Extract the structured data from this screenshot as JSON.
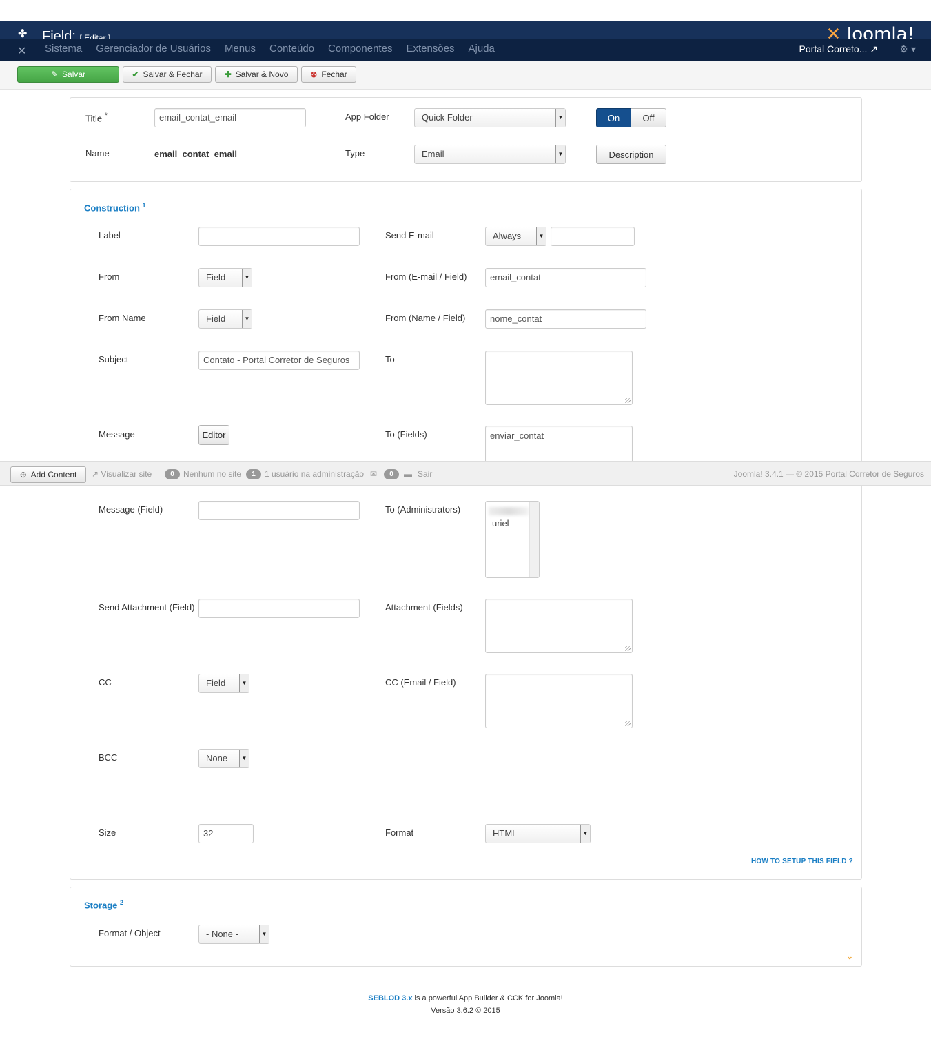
{
  "header": {
    "title": "Field:",
    "subtitle": "[ Editar ]",
    "brand": "Joomla!",
    "nav": [
      "Sistema",
      "Gerenciador de Usuários",
      "Menus",
      "Conteúdo",
      "Componentes",
      "Extensões",
      "Ajuda"
    ],
    "site_link": "Portal Correto...",
    "icons": {
      "site_logo": "joomla-icon",
      "gear": "gear-icon",
      "external": "external-link-icon"
    }
  },
  "toolbar": {
    "save": "Salvar",
    "save_close": "Salvar & Fechar",
    "save_new": "Salvar & Novo",
    "close": "Fechar"
  },
  "general": {
    "title_label": "Title",
    "title_required": "*",
    "title_value": "email_contat_email",
    "name_label": "Name",
    "name_value": "email_contat_email",
    "app_folder_label": "App Folder",
    "app_folder_value": "Quick Folder",
    "type_label": "Type",
    "type_value": "Email",
    "toggle_on": "On",
    "toggle_off": "Off",
    "description_button": "Description"
  },
  "construction": {
    "title": "Construction",
    "num": "1",
    "label_label": "Label",
    "label_value": "",
    "send_email_label": "Send E-mail",
    "send_email_value": "Always",
    "send_email_extra": "",
    "from_label": "From",
    "from_value": "Field",
    "from_email_label": "From (E-mail / Field)",
    "from_email_value": "email_contat",
    "from_name_label": "From Name",
    "from_name_value": "Field",
    "from_name_field_label": "From (Name / Field)",
    "from_name_field_value": "nome_contat",
    "subject_label": "Subject",
    "subject_value": "Contato - Portal Corretor de Seguros",
    "to_label": "To",
    "to_value": "",
    "message_label": "Message",
    "message_button": "Editor",
    "to_fields_label": "To (Fields)",
    "to_fields_value": "enviar_contat",
    "message_field_label": "Message (Field)",
    "message_field_value": "",
    "to_admins_label": "To (Administrators)",
    "to_admins_option": "uriel",
    "send_attachment_label": "Send Attachment (Field)",
    "send_attachment_value": "",
    "attachment_fields_label": "Attachment (Fields)",
    "cc_label": "CC",
    "cc_value": "Field",
    "cc_email_label": "CC (Email / Field)",
    "bcc_label": "BCC",
    "bcc_value": "None",
    "size_label": "Size",
    "size_value": "32",
    "format_label": "Format",
    "format_value": "HTML",
    "help_link": "HOW TO SETUP THIS FIELD ?"
  },
  "storage": {
    "title": "Storage",
    "num": "2",
    "format_label": "Format / Object",
    "format_value": "- None -"
  },
  "statusbar": {
    "add_content": "Add Content",
    "view_site": "Visualizar site",
    "site_count": "0",
    "site_label": "Nenhum no site",
    "admin_count": "1",
    "admin_label": "1 usuário na administração",
    "msg_count": "0",
    "logout": "Sair",
    "right_text": "Joomla! 3.4.1  —  © 2015 Portal Corretor de Seguros"
  },
  "footer": {
    "seblod": "SEBLOD 3.x",
    "tagline": "is a powerful App Builder & CCK for Joomla!",
    "version": "Versão 3.6.2 © 2015"
  },
  "colors": {
    "navbar": "#0d2242",
    "header": "#17315a",
    "accent": "#1a7ec4",
    "success": "#46a546",
    "toggle_on": "#154f8e"
  }
}
